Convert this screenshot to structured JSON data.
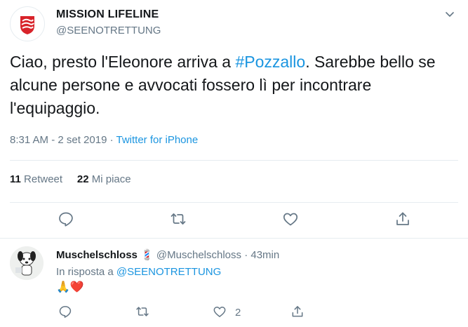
{
  "tweet": {
    "account_name": "MISSION LIFELINE",
    "handle": "@SEENOTRETTUNG",
    "text_before": "Ciao, presto l'Eleonore arriva a ",
    "hashtag": "#Pozzallo",
    "text_after": ". Sarebbe bello se alcune persone e avvocati fossero lì per incontrare l'equipaggio.",
    "timestamp": "8:31 AM - 2 set 2019",
    "separator": " · ",
    "source": "Twitter for iPhone",
    "retweet_count": "11",
    "retweet_label": "Retweet",
    "like_count": "22",
    "like_label": "Mi piace",
    "icons": [
      "reply-icon",
      "retweet-icon",
      "like-icon",
      "share-icon",
      "chevron-down-icon"
    ]
  },
  "reply": {
    "name": "Muschelschloss",
    "badge_emoji": "💈",
    "handle": "@Muschelschloss",
    "separator": " · ",
    "time": "43min",
    "in_reply_to_prefix": "In risposta a ",
    "in_reply_to_handle": "@SEENOTRETTUNG",
    "content": "🙏❤️",
    "like_count": "2"
  },
  "colors": {
    "link": "#1b95e0",
    "muted": "#657786",
    "text": "#14171a",
    "brand_red": "#d8232a",
    "divider": "#e6ecf0"
  }
}
